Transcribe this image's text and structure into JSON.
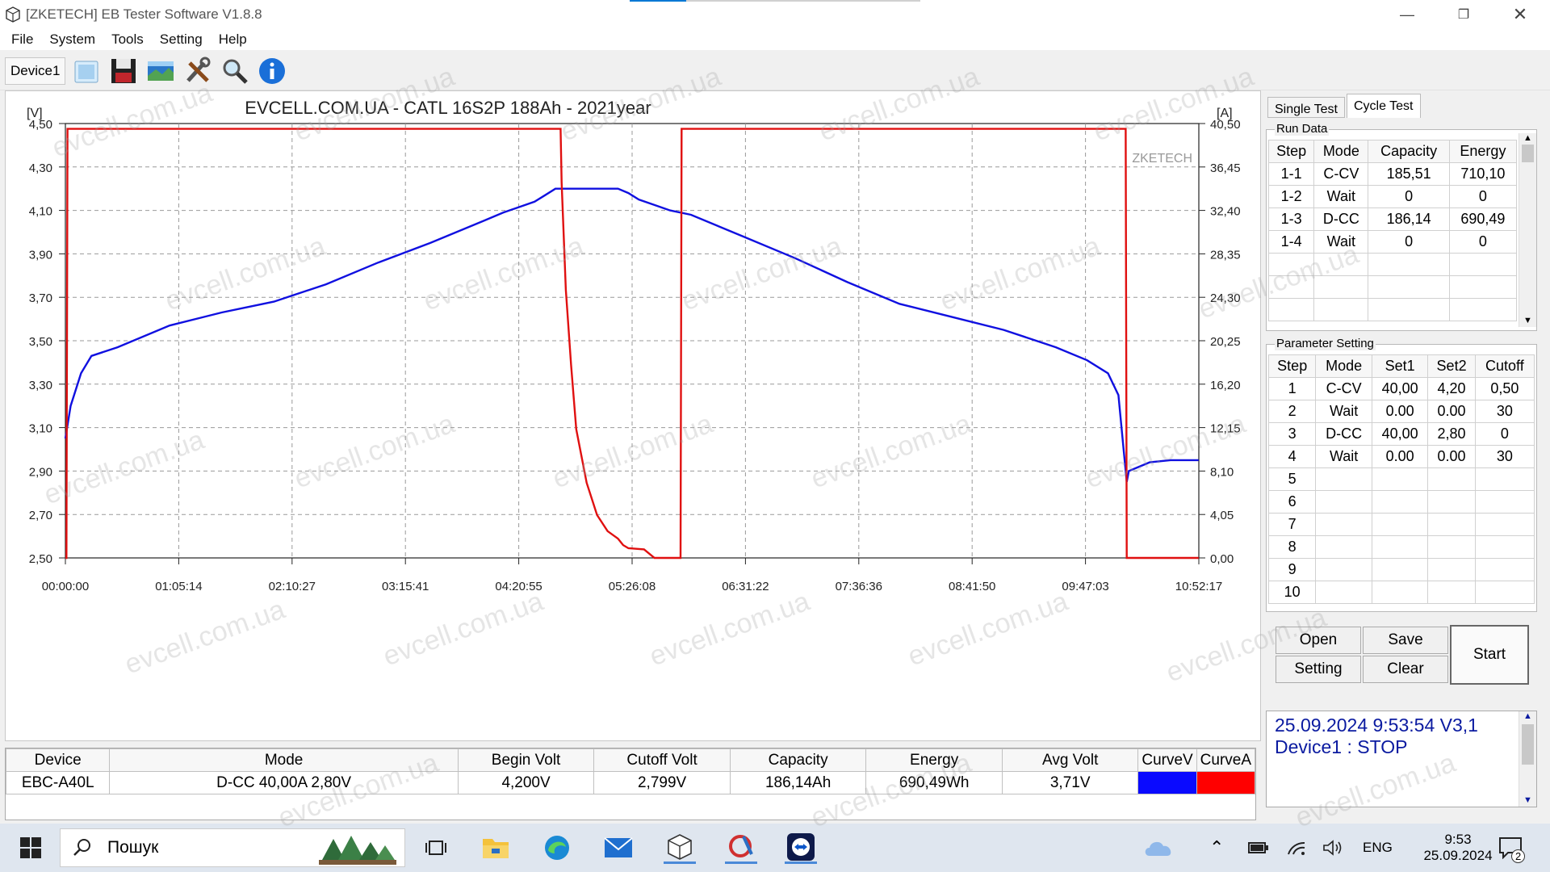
{
  "window": {
    "title": "[ZKETECH] EB Tester Software V1.8.8"
  },
  "menu": [
    "File",
    "System",
    "Tools",
    "Setting",
    "Help"
  ],
  "toolbar": {
    "device_tab": "Device1",
    "icons": [
      "open-folder-icon",
      "save-icon",
      "image-icon",
      "tools-icon",
      "search-icon",
      "info-icon"
    ]
  },
  "chart_data": {
    "type": "line",
    "title": "EVCELL.COM.UA - CATL 16S2P 188Ah - 2021year",
    "watermark_brand": "ZKETECH",
    "left_unit": "[V]",
    "right_unit": "[A]",
    "y_left_ticks": [
      "4,50",
      "4,30",
      "4,10",
      "3,90",
      "3,70",
      "3,50",
      "3,30",
      "3,10",
      "2,90",
      "2,70",
      "2,50"
    ],
    "y_right_ticks": [
      "40,50",
      "36,45",
      "32,40",
      "28,35",
      "24,30",
      "20,25",
      "16,20",
      "12,15",
      "8,10",
      "4,05",
      "0,00"
    ],
    "x_ticks": [
      "00:00:00",
      "01:05:14",
      "02:10:27",
      "03:15:41",
      "04:20:55",
      "05:26:08",
      "06:31:22",
      "07:36:36",
      "08:41:50",
      "09:47:03",
      "10:52:17"
    ],
    "ylim_left": [
      2.5,
      4.5
    ],
    "ylim_right": [
      0,
      40.5
    ],
    "xlim_hours": [
      0,
      10.8714
    ],
    "series": [
      {
        "axis": "left",
        "color": "#1010e0",
        "points": [
          [
            0,
            3.05
          ],
          [
            0.05,
            3.2
          ],
          [
            0.15,
            3.35
          ],
          [
            0.25,
            3.43
          ],
          [
            0.5,
            3.47
          ],
          [
            1,
            3.57
          ],
          [
            1.5,
            3.63
          ],
          [
            2,
            3.68
          ],
          [
            2.5,
            3.76
          ],
          [
            3,
            3.86
          ],
          [
            3.5,
            3.95
          ],
          [
            4,
            4.05
          ],
          [
            4.2,
            4.09
          ],
          [
            4.5,
            4.14
          ],
          [
            4.6,
            4.17
          ],
          [
            4.7,
            4.2
          ],
          [
            5.3,
            4.2
          ],
          [
            5.4,
            4.18
          ],
          [
            5.5,
            4.15
          ],
          [
            5.8,
            4.1
          ],
          [
            6,
            4.08
          ],
          [
            6.5,
            3.98
          ],
          [
            7,
            3.88
          ],
          [
            7.5,
            3.77
          ],
          [
            8,
            3.67
          ],
          [
            8.5,
            3.61
          ],
          [
            9,
            3.55
          ],
          [
            9.5,
            3.47
          ],
          [
            9.8,
            3.41
          ],
          [
            10,
            3.35
          ],
          [
            10.1,
            3.25
          ],
          [
            10.15,
            3.0
          ],
          [
            10.18,
            2.85
          ],
          [
            10.2,
            2.9
          ],
          [
            10.4,
            2.94
          ],
          [
            10.6,
            2.95
          ],
          [
            10.87,
            2.95
          ]
        ]
      },
      {
        "axis": "right",
        "color": "#e01010",
        "points": [
          [
            0,
            0
          ],
          [
            0.01,
            0
          ],
          [
            0.02,
            40
          ],
          [
            4.75,
            40
          ],
          [
            4.76,
            35
          ],
          [
            4.8,
            25
          ],
          [
            4.85,
            18
          ],
          [
            4.9,
            12
          ],
          [
            5.0,
            7
          ],
          [
            5.1,
            4
          ],
          [
            5.2,
            2.5
          ],
          [
            5.3,
            1.8
          ],
          [
            5.35,
            1.2
          ],
          [
            5.4,
            0.9
          ],
          [
            5.55,
            0.8
          ],
          [
            5.65,
            0
          ],
          [
            5.9,
            0
          ],
          [
            5.91,
            40
          ],
          [
            10.17,
            40
          ],
          [
            10.18,
            0
          ],
          [
            10.87,
            0
          ]
        ]
      }
    ]
  },
  "right_panel": {
    "tabs": [
      "Single Test",
      "Cycle Test"
    ],
    "active_tab": "Cycle Test",
    "run_data": {
      "label": "Run Data",
      "headers": [
        "Step",
        "Mode",
        "Capacity",
        "Energy"
      ],
      "rows": [
        [
          "1-1",
          "C-CV",
          "185,51",
          "710,10"
        ],
        [
          "1-2",
          "Wait",
          "0",
          "0"
        ],
        [
          "1-3",
          "D-CC",
          "186,14",
          "690,49"
        ],
        [
          "1-4",
          "Wait",
          "0",
          "0"
        ]
      ]
    },
    "param_setting": {
      "label": "Parameter Setting",
      "headers": [
        "Step",
        "Mode",
        "Set1",
        "Set2",
        "Cutoff"
      ],
      "rows": [
        [
          "1",
          "C-CV",
          "40,00",
          "4,20",
          "0,50"
        ],
        [
          "2",
          "Wait",
          "0.00",
          "0.00",
          "30"
        ],
        [
          "3",
          "D-CC",
          "40,00",
          "2,80",
          "0"
        ],
        [
          "4",
          "Wait",
          "0.00",
          "0.00",
          "30"
        ],
        [
          "5",
          "",
          "",
          "",
          ""
        ],
        [
          "6",
          "",
          "",
          "",
          ""
        ],
        [
          "7",
          "",
          "",
          "",
          ""
        ],
        [
          "8",
          "",
          "",
          "",
          ""
        ],
        [
          "9",
          "",
          "",
          "",
          ""
        ],
        [
          "10",
          "",
          "",
          "",
          ""
        ]
      ]
    },
    "buttons": {
      "open": "Open",
      "save": "Save",
      "setting": "Setting",
      "clear": "Clear",
      "start": "Start"
    },
    "status": {
      "line1": "25.09.2024 9:53:54  V3,1",
      "line2": "Device1 : STOP"
    }
  },
  "summary": {
    "headers": [
      "Device",
      "Mode",
      "Begin Volt",
      "Cutoff Volt",
      "Capacity",
      "Energy",
      "Avg Volt",
      "CurveV",
      "CurveA"
    ],
    "row": [
      "EBC-A40L",
      "D-CC  40,00A  2,80V",
      "4,200V",
      "2,799V",
      "186,14Ah",
      "690,49Wh",
      "3,71V"
    ],
    "curve_colors": {
      "v": "#0a0aff",
      "a": "#ff0000"
    }
  },
  "taskbar": {
    "search_placeholder": "Пошук",
    "lang": "ENG",
    "time": "9:53",
    "date": "25.09.2024",
    "notif_count": "2"
  },
  "watermark_text": "evcell.com.ua"
}
